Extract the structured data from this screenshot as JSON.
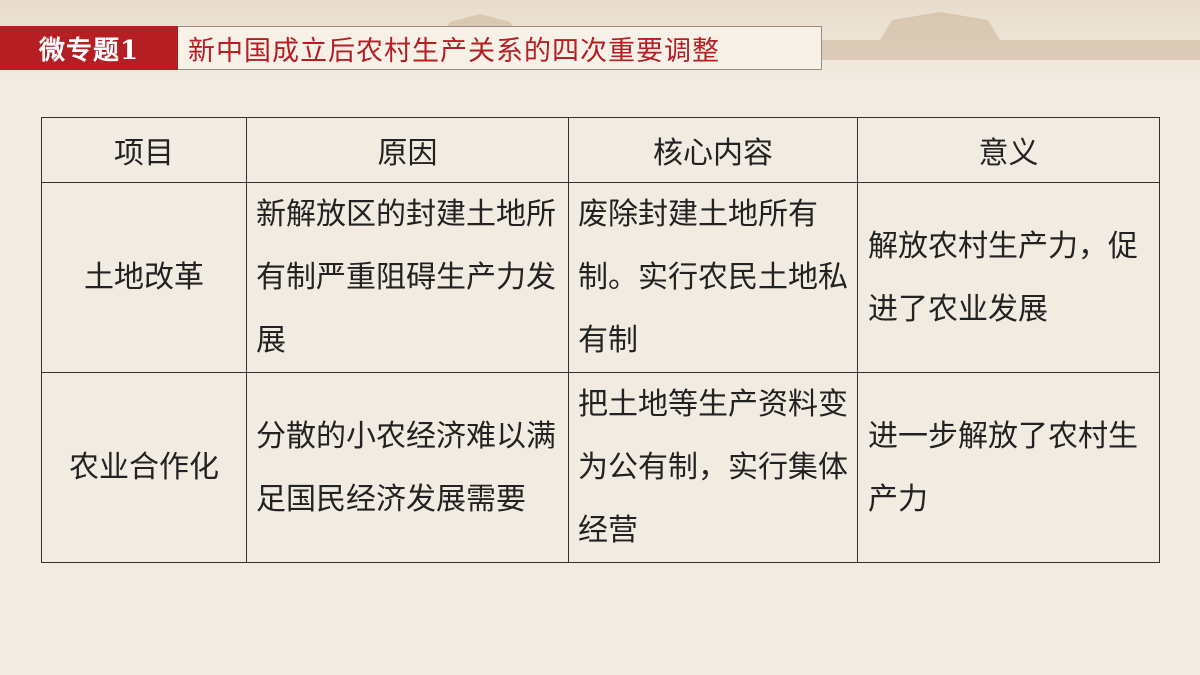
{
  "header": {
    "badge": "微专题1",
    "title": "新中国成立后农村生产关系的四次重要调整"
  },
  "table": {
    "columns": [
      "项目",
      "原因",
      "核心内容",
      "意义"
    ],
    "rows": [
      {
        "item": "土地改革",
        "reason": "新解放区的封建土地所有制严重阻碍生产力发展",
        "content": "废除封建土地所有制。实行农民土地私有制",
        "meaning": "解放农村生产力，促进了农业发展"
      },
      {
        "item": "农业合作化",
        "reason": "分散的小农经济难以满足国民经济发展需要",
        "content": "把土地等生产资料变为公有制，实行集体经营",
        "meaning": "进一步解放了农村生产力"
      }
    ]
  },
  "colors": {
    "accent": "#b51e22",
    "background": "#f1ebe1"
  }
}
